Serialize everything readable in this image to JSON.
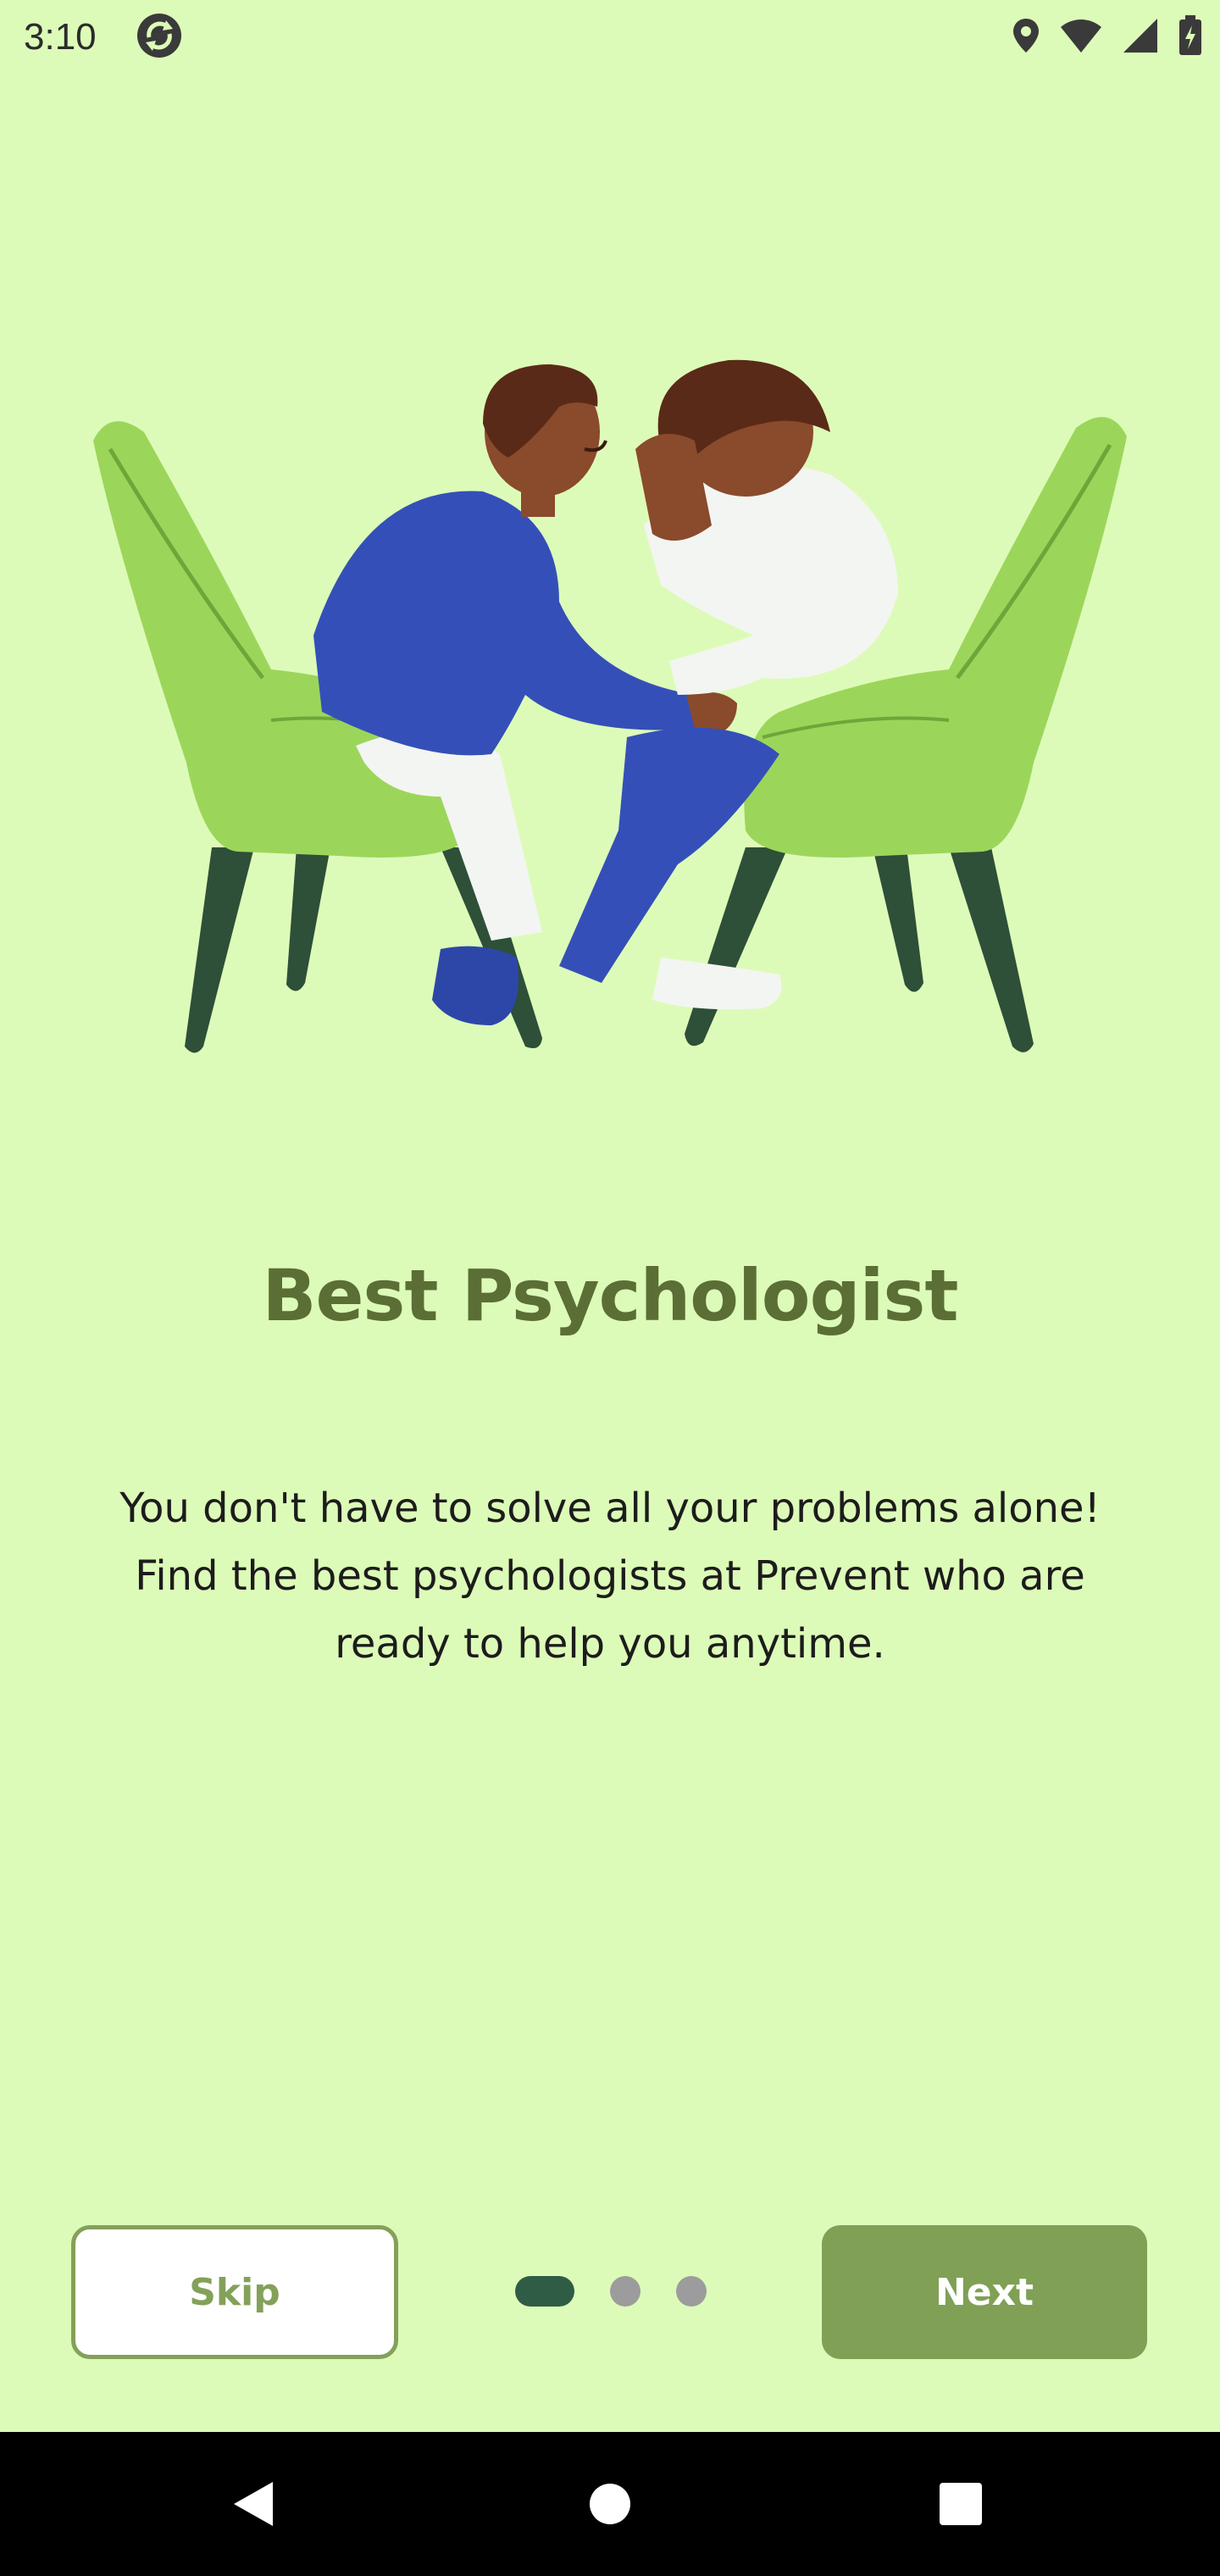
{
  "status_bar": {
    "time": "3:10",
    "icons": [
      "sync-icon",
      "location-icon",
      "wifi-icon",
      "signal-icon",
      "battery-charging-icon"
    ]
  },
  "onboarding": {
    "title": "Best Psychologist",
    "description": "You don't have to solve all your problems alone! Find the best psychologists at Prevent who are ready to help you anytime.",
    "current_page": 1,
    "total_pages": 3
  },
  "actions": {
    "skip_label": "Skip",
    "next_label": "Next"
  },
  "colors": {
    "background": "#DDFBB8",
    "title": "#5B6E35",
    "accent": "#7FA055",
    "active_dot": "#2F5C45",
    "inactive_dot": "#9C9C9C"
  },
  "nav_bar": {
    "icons": [
      "back-icon",
      "home-icon",
      "recents-icon"
    ]
  }
}
